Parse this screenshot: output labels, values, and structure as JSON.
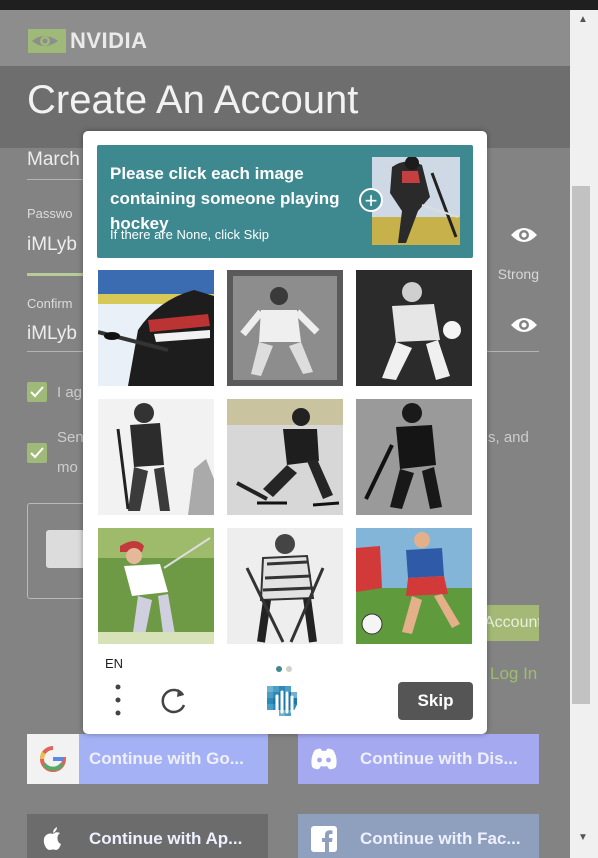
{
  "brand": {
    "name": "NVIDIA"
  },
  "page": {
    "title": "Create An Account",
    "month_value": "March",
    "password_label": "Passwo",
    "password_value": "iMLyb",
    "strength": "Strong",
    "confirm_label": "Confirm",
    "confirm_value": "iMLyb",
    "agree_text": "I ag",
    "send_text": "Sen",
    "send_text2": "mo",
    "send_tail": "s, and",
    "create_button": "Account",
    "login_link": "Log In"
  },
  "social": [
    {
      "label": "Continue with Go...",
      "icon": "google-icon"
    },
    {
      "label": "Continue with Dis...",
      "icon": "discord-icon"
    },
    {
      "label": "Continue with Ap...",
      "icon": "apple-icon"
    },
    {
      "label": "Continue with Fac...",
      "icon": "facebook-icon"
    }
  ],
  "captcha": {
    "prompt": "Please click each image containing someone playing hockey",
    "subtext": "If there are None, click Skip",
    "language": "EN",
    "skip_label": "Skip",
    "page_indicator": {
      "current": 1,
      "total": 2
    },
    "tiles": [
      {
        "subject": "hockey player in striped jersey"
      },
      {
        "subject": "soccer goalkeeper sketch"
      },
      {
        "subject": "soccer player with ball sketch"
      },
      {
        "subject": "golfer sketch"
      },
      {
        "subject": "hockey player skating"
      },
      {
        "subject": "hockey player silhouette"
      },
      {
        "subject": "golfer swinging club"
      },
      {
        "subject": "hockey players sketch"
      },
      {
        "subject": "soccer players in color"
      }
    ]
  },
  "colors": {
    "prompt_bg": "#3e8890",
    "accent_green": "#9fb978",
    "skip_bg": "#555555"
  }
}
